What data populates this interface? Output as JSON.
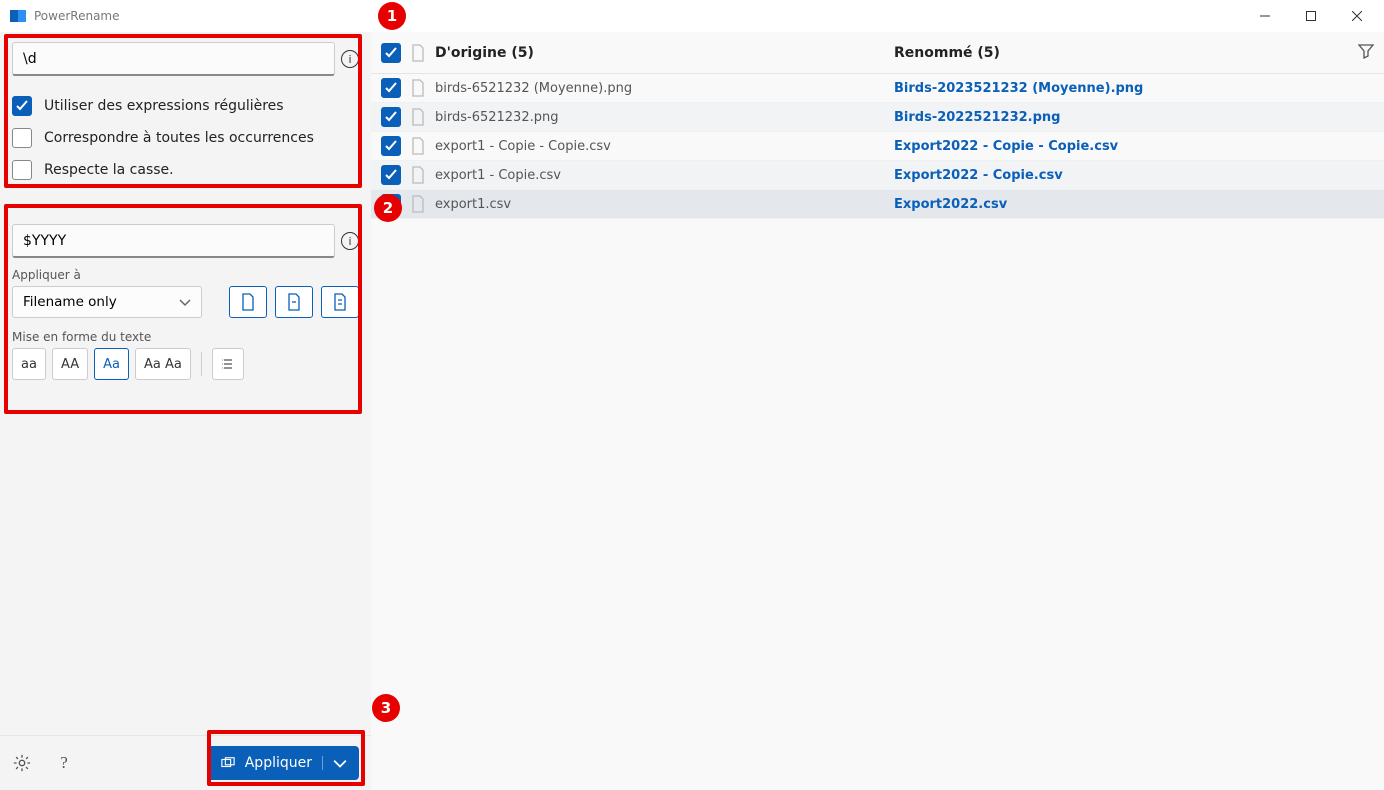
{
  "app": {
    "title": "PowerRename"
  },
  "search": {
    "value": "\\d",
    "opt_regex": "Utiliser des expressions régulières",
    "opt_regex_checked": true,
    "opt_allocc": "Correspondre à toutes les occurrences",
    "opt_allocc_checked": false,
    "opt_case": "Respecte la casse.",
    "opt_case_checked": false
  },
  "replace": {
    "value": "$YYYY",
    "apply_label": "Appliquer à",
    "apply_select": "Filename only",
    "format_label": "Mise en forme du texte",
    "fmt": {
      "aa": "aa",
      "AA": "AA",
      "Aa": "Aa",
      "AaAa": "Aa Aa"
    }
  },
  "footer": {
    "apply": "Appliquer"
  },
  "list": {
    "header_orig": "D'origine (5)",
    "header_ren": "Renommé (5)",
    "rows": [
      {
        "orig": "birds-6521232 (Moyenne).png",
        "ren": "Birds-2023521232 (Moyenne).png"
      },
      {
        "orig": "birds-6521232.png",
        "ren": "Birds-2022521232.png"
      },
      {
        "orig": "export1 - Copie - Copie.csv",
        "ren": "Export2022 - Copie - Copie.csv"
      },
      {
        "orig": "export1 - Copie.csv",
        "ren": "Export2022 - Copie.csv"
      },
      {
        "orig": "export1.csv",
        "ren": "Export2022.csv"
      }
    ]
  },
  "annotations": {
    "b1": "1",
    "b2": "2",
    "b3": "3"
  }
}
